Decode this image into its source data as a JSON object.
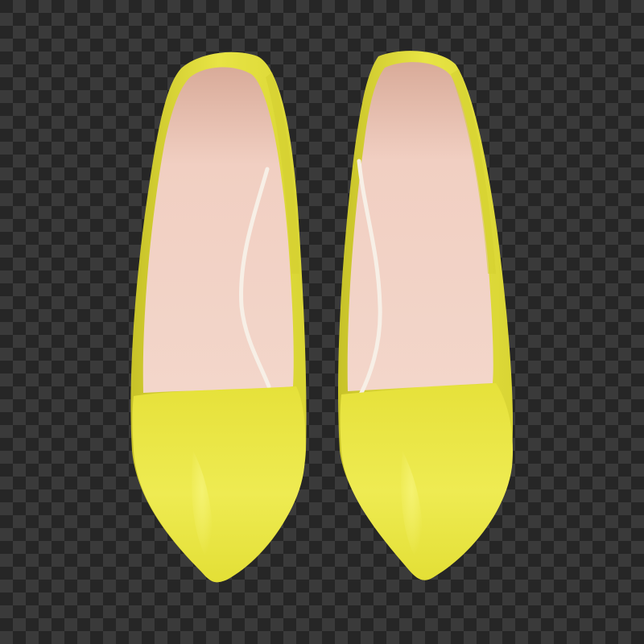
{
  "image": {
    "subject": "pair-of-yellow-pointed-toe-pumps",
    "view": "top-down",
    "background": "transparency-checkerboard"
  },
  "colors": {
    "checker_dark": "#262626",
    "checker_light": "#3a3a3a",
    "upper_yellow": "#ecea4a",
    "upper_yellow_shade": "#c9c52a",
    "upper_yellow_highlight": "#f6f47a",
    "lining_pink": "#f1cfc1",
    "lining_pink_shade": "#d8aa98",
    "insole_edge": "#f7efe6"
  }
}
